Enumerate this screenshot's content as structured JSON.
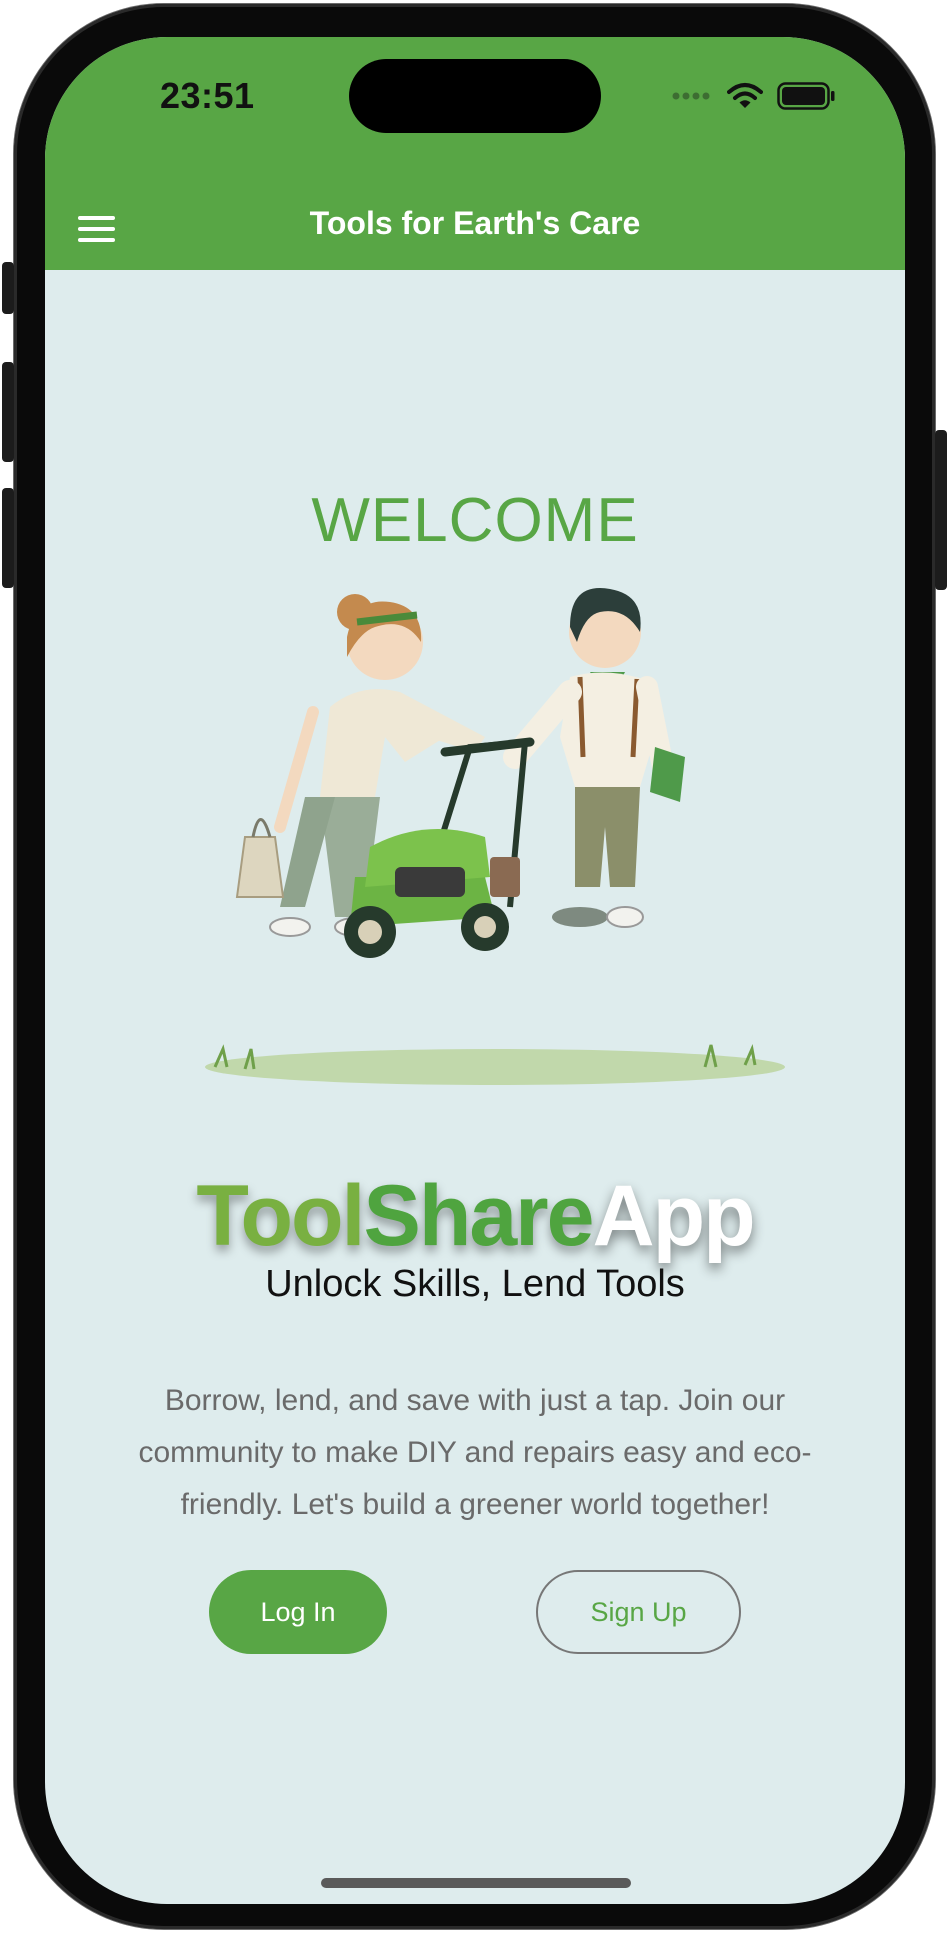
{
  "status_bar": {
    "time": "23:51"
  },
  "nav": {
    "title": "Tools for Earth's Care",
    "menu_icon": "hamburger-menu-icon"
  },
  "main": {
    "welcome": "WELCOME",
    "brand": {
      "part1": "Tool",
      "part2": "Share",
      "part3": "App"
    },
    "tagline": "Unlock Skills, Lend Tools",
    "description": "Borrow, lend, and save with just a tap. Join our community to make DIY and repairs easy and eco-friendly. Let's build a greener world together!",
    "login_label": "Log In",
    "signup_label": "Sign Up"
  },
  "colors": {
    "primary_green": "#58a645",
    "background": "#deeced",
    "tool_green": "#79b041",
    "text_gray": "#6a6a6a"
  }
}
